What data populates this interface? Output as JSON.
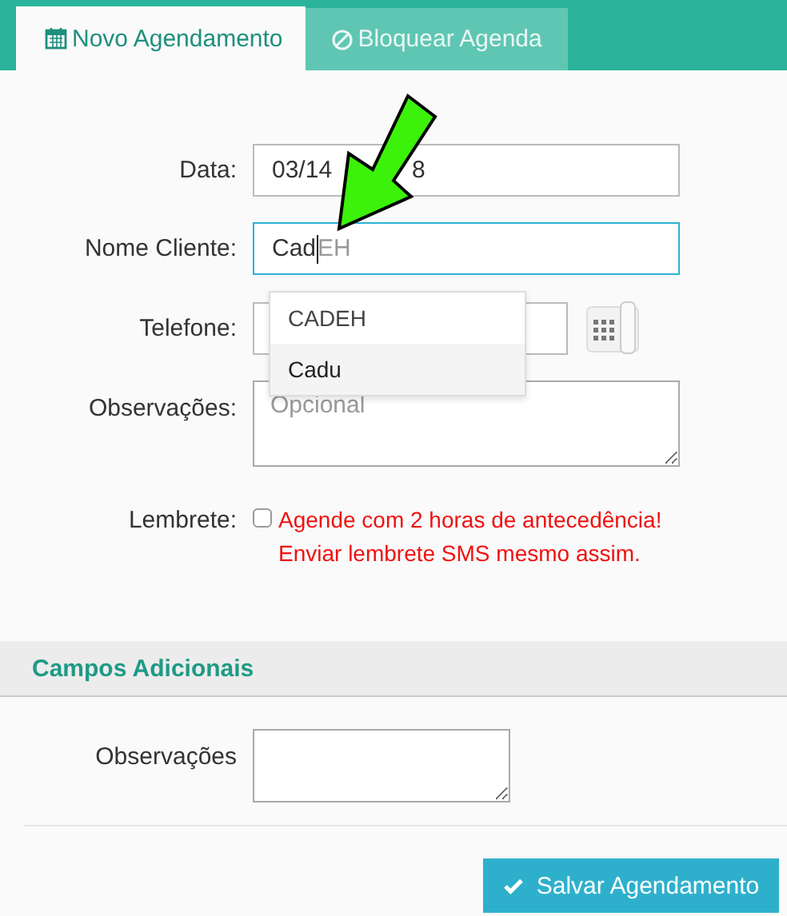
{
  "tabs": [
    {
      "label": "Novo Agendamento",
      "kind": "calendar",
      "selected": true
    },
    {
      "label": "Bloquear Agenda",
      "kind": "ban",
      "selected": false
    }
  ],
  "form": {
    "date": {
      "label": "Data:",
      "value_start": "03/14",
      "value_end": "8"
    },
    "client": {
      "label": "Nome Cliente:",
      "typed": "Cad",
      "suggestion": "EH",
      "focused": true
    },
    "autocomplete": [
      {
        "label": "CADEH",
        "selected": false
      },
      {
        "label": "Cadu",
        "selected": true
      }
    ],
    "phone": {
      "label": "Telefone:"
    },
    "notes": {
      "label": "Observações:",
      "placeholder": "Opcional"
    },
    "reminder": {
      "label": "Lembrete:",
      "checked": false,
      "text": "Agende com 2 horas de antecedência! Enviar lembrete SMS mesmo assim."
    }
  },
  "extra": {
    "title": "Campos Adicionais",
    "notes_label": "Observações"
  },
  "save_button": "Salvar Agendamento"
}
